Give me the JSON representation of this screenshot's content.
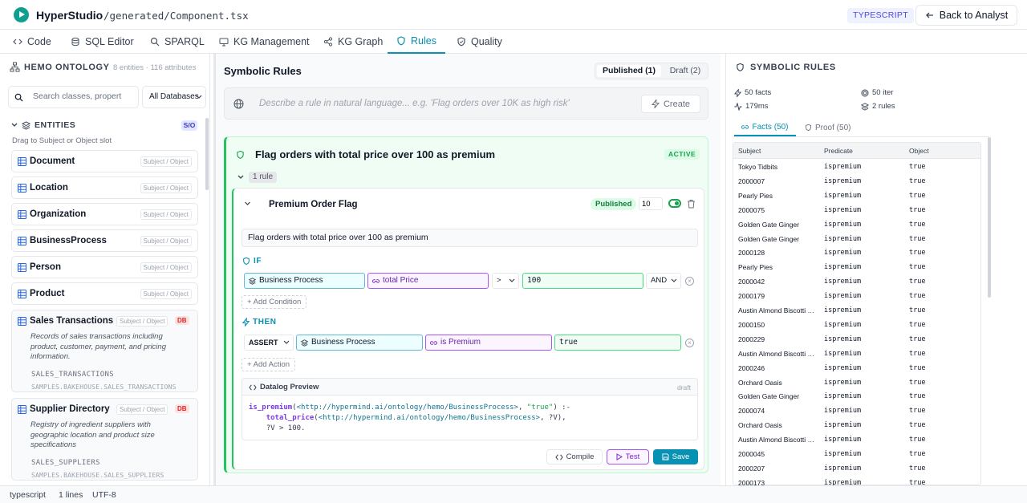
{
  "header": {
    "app_name": "HyperStudio",
    "file_path": "/generated/Component.tsx",
    "language_badge": "TYPESCRIPT",
    "back_label": "Back to Analyst"
  },
  "tabs": [
    {
      "label": "Code",
      "icon": "code-icon"
    },
    {
      "label": "SQL Editor",
      "icon": "database-icon"
    },
    {
      "label": "SPARQL",
      "icon": "search-icon"
    },
    {
      "label": "KG Management",
      "icon": "monitor-icon"
    },
    {
      "label": "KG Graph",
      "icon": "share-icon"
    },
    {
      "label": "Rules",
      "icon": "shield-icon",
      "active": true
    },
    {
      "label": "Quality",
      "icon": "shield-check-icon"
    }
  ],
  "ontology": {
    "title": "HEMO ONTOLOGY",
    "meta": "8 entities · 116 attributes",
    "search_placeholder": "Search classes, propert",
    "db_select": "All Databases",
    "entities_label": "ENTITIES",
    "entities_count": "S/O",
    "drag_hint": "Drag to Subject or Object slot",
    "slot_tag": "Subject / Object",
    "db_tag": "DB",
    "entities": [
      "Document",
      "Location",
      "Organization",
      "BusinessProcess",
      "Person",
      "Product"
    ],
    "db_entities": [
      {
        "name": "Sales Transactions",
        "description": "Records of sales transactions including product, customer, payment, and pricing information.",
        "table": "SALES_TRANSACTIONS",
        "fq": "SAMPLES.BAKEHOUSE.SALES_TRANSACTIONS"
      },
      {
        "name": "Supplier Directory",
        "description": "Registry of ingredient suppliers with geographic location and product size specifications",
        "table": "SALES_SUPPLIERS",
        "fq": "SAMPLES.BAKEHOUSE.SALES_SUPPLIERS"
      }
    ]
  },
  "rules": {
    "title": "Symbolic Rules",
    "published_tab": "Published (1)",
    "draft_tab": "Draft (2)",
    "nl_placeholder": "Describe a rule in natural language... e.g. 'Flag orders over 10K as high risk'",
    "create_label": "Create",
    "group_title": "Flag orders with total price over 100 as premium",
    "group_status": "ACTIVE",
    "rule_count": "1 rule",
    "card": {
      "name": "Premium Order Flag",
      "status": "Published",
      "priority": "10",
      "description": "Flag orders with total price over 100 as premium",
      "if_label": "IF",
      "then_label": "THEN",
      "condition": {
        "class": "Business Process",
        "property": "total Price",
        "operator": ">",
        "value": "100",
        "joiner": "AND"
      },
      "add_condition": "+ Add Condition",
      "action": {
        "verb": "ASSERT",
        "class": "Business Process",
        "property": "is Premium",
        "value": "true"
      },
      "add_action": "+ Add Action",
      "datalog_title": "Datalog Preview",
      "datalog_state": "draft",
      "datalog": {
        "head_pred": "is_premium",
        "head_uri": "<http://hypermind.ai/ontology/hemo/BusinessProcess>",
        "head_val": "\"true\"",
        "body_pred": "total_price",
        "body_uri": "<http://hypermind.ai/ontology/hemo/BusinessProcess>",
        "cmp": "?V > 100."
      },
      "compile_label": "Compile",
      "test_label": "Test",
      "save_label": "Save"
    }
  },
  "symbolic": {
    "title": "SYMBOLIC RULES",
    "stats": {
      "facts": "50 facts",
      "iter": "50 iter",
      "time": "179ms",
      "rules": "2 rules"
    },
    "facts_tab": "Facts (50)",
    "proof_tab": "Proof (50)",
    "columns": [
      "Subject",
      "Predicate",
      "Object"
    ],
    "rows": [
      [
        "Tokyo Tidbits",
        "ispremium",
        "true"
      ],
      [
        "2000007",
        "ispremium",
        "true"
      ],
      [
        "Pearly Pies",
        "ispremium",
        "true"
      ],
      [
        "2000075",
        "ispremium",
        "true"
      ],
      [
        "Golden Gate Ginger",
        "ispremium",
        "true"
      ],
      [
        "Golden Gate Ginger",
        "ispremium",
        "true"
      ],
      [
        "2000128",
        "ispremium",
        "true"
      ],
      [
        "Pearly Pies",
        "ispremium",
        "true"
      ],
      [
        "2000042",
        "ispremium",
        "true"
      ],
      [
        "2000179",
        "ispremium",
        "true"
      ],
      [
        "Austin Almond Biscotti Bakery",
        "ispremium",
        "true"
      ],
      [
        "2000150",
        "ispremium",
        "true"
      ],
      [
        "2000229",
        "ispremium",
        "true"
      ],
      [
        "Austin Almond Biscotti Bakery",
        "ispremium",
        "true"
      ],
      [
        "2000246",
        "ispremium",
        "true"
      ],
      [
        "Orchard Oasis",
        "ispremium",
        "true"
      ],
      [
        "Golden Gate Ginger",
        "ispremium",
        "true"
      ],
      [
        "2000074",
        "ispremium",
        "true"
      ],
      [
        "Orchard Oasis",
        "ispremium",
        "true"
      ],
      [
        "Austin Almond Biscotti Bakery",
        "ispremium",
        "true"
      ],
      [
        "2000045",
        "ispremium",
        "true"
      ],
      [
        "2000207",
        "ispremium",
        "true"
      ],
      [
        "2000173",
        "ispremium",
        "true"
      ]
    ]
  },
  "statusbar": {
    "language": "typescript",
    "lines": "1 lines",
    "encoding": "UTF-8"
  },
  "colors": {
    "accent": "#0891b2",
    "success": "#22c55e",
    "brand": "#0e9f8e",
    "property": "#a855f7"
  }
}
